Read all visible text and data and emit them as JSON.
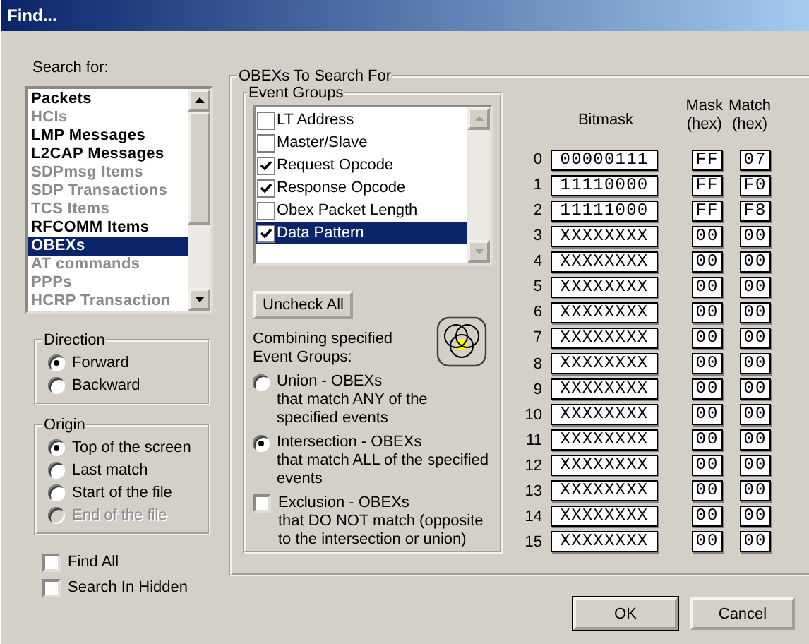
{
  "window": {
    "title": "Find..."
  },
  "search_for": {
    "label": "Search for:",
    "items": [
      {
        "label": "Packets",
        "disabled": false,
        "selected": false
      },
      {
        "label": "HCIs",
        "disabled": true,
        "selected": false
      },
      {
        "label": "LMP Messages",
        "disabled": false,
        "selected": false
      },
      {
        "label": "L2CAP Messages",
        "disabled": false,
        "selected": false
      },
      {
        "label": "SDPmsg Items",
        "disabled": true,
        "selected": false
      },
      {
        "label": "SDP Transactions",
        "disabled": true,
        "selected": false
      },
      {
        "label": "TCS Items",
        "disabled": true,
        "selected": false
      },
      {
        "label": "RFCOMM Items",
        "disabled": false,
        "selected": false
      },
      {
        "label": "OBEXs",
        "disabled": false,
        "selected": true
      },
      {
        "label": "AT commands",
        "disabled": true,
        "selected": false
      },
      {
        "label": "PPPs",
        "disabled": true,
        "selected": false
      },
      {
        "label": "HCRP Transaction",
        "disabled": true,
        "selected": false
      }
    ]
  },
  "direction": {
    "title": "Direction",
    "options": [
      {
        "label": "Forward",
        "selected": true,
        "disabled": false
      },
      {
        "label": "Backward",
        "selected": false,
        "disabled": false
      }
    ]
  },
  "origin": {
    "title": "Origin",
    "options": [
      {
        "label": "Top of the screen",
        "selected": true,
        "disabled": false
      },
      {
        "label": "Last match",
        "selected": false,
        "disabled": false
      },
      {
        "label": "Start of the file",
        "selected": false,
        "disabled": false
      },
      {
        "label": "End of the file",
        "selected": false,
        "disabled": true
      }
    ]
  },
  "options": [
    {
      "label": "Find All",
      "checked": false
    },
    {
      "label": "Search In Hidden",
      "checked": false
    }
  ],
  "obex": {
    "title": "OBEXs To Search For",
    "event_groups": {
      "title": "Event Groups",
      "items": [
        {
          "label": "LT Address",
          "checked": false,
          "selected": false
        },
        {
          "label": "Master/Slave",
          "checked": false,
          "selected": false
        },
        {
          "label": "Request Opcode",
          "checked": true,
          "selected": false
        },
        {
          "label": "Response Opcode",
          "checked": true,
          "selected": false
        },
        {
          "label": "Obex Packet Length",
          "checked": false,
          "selected": false
        },
        {
          "label": "Data Pattern",
          "checked": true,
          "selected": true
        }
      ],
      "uncheck_all": "Uncheck All",
      "combining_label": "Combining specified Event Groups:",
      "modes": [
        {
          "kind": "radio",
          "title": "Union - OBEXs",
          "text": "that match ANY of the specified events",
          "selected": false
        },
        {
          "kind": "radio",
          "title": "Intersection - OBEXs",
          "text": "that match ALL of the specified events",
          "selected": true
        },
        {
          "kind": "checkbox",
          "title": "Exclusion - OBEXs",
          "text": "that DO NOT match (opposite to the intersection or union)",
          "checked": false
        }
      ]
    },
    "columns": [
      {
        "title": "Bitmask"
      },
      {
        "title": "Mask",
        "unit": "(hex)"
      },
      {
        "title": "Match",
        "unit": "(hex)"
      }
    ],
    "rows": [
      {
        "index": "0",
        "bitmask": "00000111",
        "mask": "FF",
        "match": "07"
      },
      {
        "index": "1",
        "bitmask": "11110000",
        "mask": "FF",
        "match": "F0"
      },
      {
        "index": "2",
        "bitmask": "11111000",
        "mask": "FF",
        "match": "F8"
      },
      {
        "index": "3",
        "bitmask": "XXXXXXXX",
        "mask": "00",
        "match": "00"
      },
      {
        "index": "4",
        "bitmask": "XXXXXXXX",
        "mask": "00",
        "match": "00"
      },
      {
        "index": "5",
        "bitmask": "XXXXXXXX",
        "mask": "00",
        "match": "00"
      },
      {
        "index": "6",
        "bitmask": "XXXXXXXX",
        "mask": "00",
        "match": "00"
      },
      {
        "index": "7",
        "bitmask": "XXXXXXXX",
        "mask": "00",
        "match": "00"
      },
      {
        "index": "8",
        "bitmask": "XXXXXXXX",
        "mask": "00",
        "match": "00"
      },
      {
        "index": "9",
        "bitmask": "XXXXXXXX",
        "mask": "00",
        "match": "00"
      },
      {
        "index": "10",
        "bitmask": "XXXXXXXX",
        "mask": "00",
        "match": "00"
      },
      {
        "index": "11",
        "bitmask": "XXXXXXXX",
        "mask": "00",
        "match": "00"
      },
      {
        "index": "12",
        "bitmask": "XXXXXXXX",
        "mask": "00",
        "match": "00"
      },
      {
        "index": "13",
        "bitmask": "XXXXXXXX",
        "mask": "00",
        "match": "00"
      },
      {
        "index": "14",
        "bitmask": "XXXXXXXX",
        "mask": "00",
        "match": "00"
      },
      {
        "index": "15",
        "bitmask": "XXXXXXXX",
        "mask": "00",
        "match": "00"
      }
    ]
  },
  "buttons": [
    {
      "label": "OK",
      "default": true
    },
    {
      "label": "Cancel",
      "default": false
    }
  ]
}
